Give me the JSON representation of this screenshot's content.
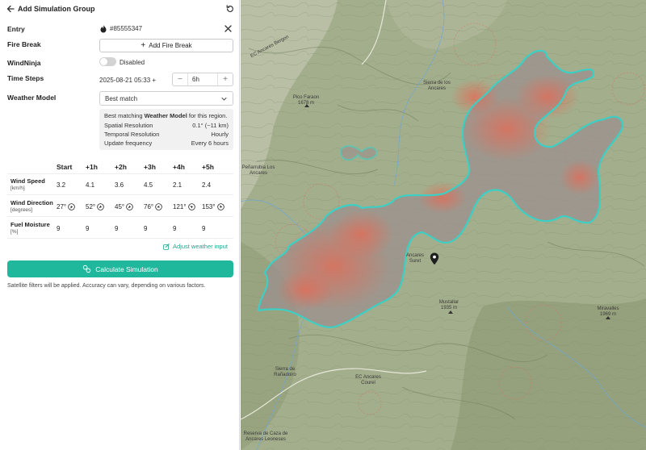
{
  "header": {
    "title": "Add Simulation Group"
  },
  "entry": {
    "label": "Entry",
    "value": "#85555347"
  },
  "fire_break": {
    "label": "Fire Break",
    "button_label": "Add Fire Break"
  },
  "windninja": {
    "label": "WindNinja",
    "state_text": "Disabled"
  },
  "time_steps": {
    "label": "Time Steps",
    "datetime": "2025-08-21 05:33 +",
    "step_value": "6h"
  },
  "weather_model": {
    "label": "Weather Model",
    "selected": "Best match",
    "info": {
      "title_prefix": "Best matching ",
      "title_bold": "Weather Model",
      "title_suffix": " for this region.",
      "rows": [
        {
          "key": "Spatial Resolution",
          "value": "0.1° (~11 km)"
        },
        {
          "key": "Temporal Resolution",
          "value": "Hourly"
        },
        {
          "key": "Update frequency",
          "value": "Every 6 hours"
        }
      ]
    }
  },
  "weather_table": {
    "columns": [
      "Start",
      "+1h",
      "+2h",
      "+3h",
      "+4h",
      "+5h"
    ],
    "rows": [
      {
        "label": "Wind Speed",
        "unit": "[km/h]",
        "values": [
          "3.2",
          "4.1",
          "3.6",
          "4.5",
          "2.1",
          "2.4"
        ]
      },
      {
        "label": "Wind Direction",
        "unit": "[degrees]",
        "values": [
          "27°",
          "52°",
          "45°",
          "76°",
          "121°",
          "153°"
        ],
        "degrees": [
          27,
          52,
          45,
          76,
          121,
          153
        ]
      },
      {
        "label": "Fuel Moisture",
        "unit": "[%]",
        "values": [
          "9",
          "9",
          "9",
          "9",
          "9",
          "9"
        ]
      }
    ]
  },
  "adjust_link": "Adjust weather input",
  "calculate_button": "Calculate Simulation",
  "note": "Satellite filters will be applied. Accuracy can vary, depending on various factors.",
  "colors": {
    "accent": "#1fb89c",
    "perimeter": "#3ecfc4",
    "fire": "#e0644f"
  },
  "map": {
    "labels": [
      {
        "text": "EC Ancares Bergon",
        "rotated": true
      },
      {
        "text": "Pico Faraon 1678 m"
      },
      {
        "text": "Sierra de los Ancares"
      },
      {
        "text": "Peñarrubia Los Ancares"
      },
      {
        "text": "Ancares Suret"
      },
      {
        "text": "Mustallar 1935 m"
      },
      {
        "text": "Miravalles 1969 m"
      },
      {
        "text": "EC Ancares Courel"
      },
      {
        "text": "Sierra de Rañadoiro"
      },
      {
        "text": "Reserva de Caza de Ancares Leoneses"
      }
    ]
  }
}
